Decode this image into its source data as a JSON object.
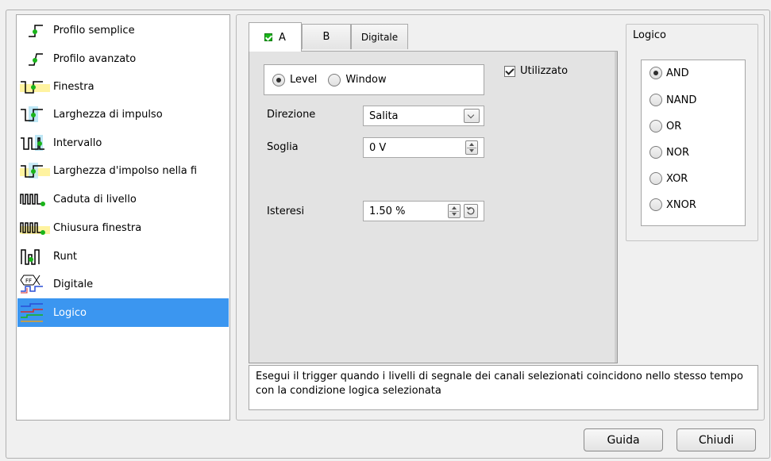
{
  "trigger_types": {
    "items": [
      {
        "label": "Profilo semplice",
        "icon": "simple-edge-icon"
      },
      {
        "label": "Profilo avanzato",
        "icon": "advanced-edge-icon"
      },
      {
        "label": "Finestra",
        "icon": "window-icon"
      },
      {
        "label": "Larghezza di impulso",
        "icon": "pulse-width-icon"
      },
      {
        "label": "Intervallo",
        "icon": "interval-icon"
      },
      {
        "label": "Larghezza d'impolso nella fi",
        "icon": "window-pulse-width-icon"
      },
      {
        "label": "Caduta di livello",
        "icon": "level-dropout-icon"
      },
      {
        "label": "Chiusura finestra",
        "icon": "window-dropout-icon"
      },
      {
        "label": "Runt",
        "icon": "runt-icon"
      },
      {
        "label": "Digitale",
        "icon": "digital-icon"
      },
      {
        "label": "Logico",
        "icon": "logic-icon"
      }
    ],
    "selected": "Logico"
  },
  "tabs": [
    {
      "label": "A",
      "checked": true,
      "active": true
    },
    {
      "label": "B",
      "checked": false,
      "active": false
    },
    {
      "label": "Digitale",
      "checked": false,
      "active": false
    }
  ],
  "channel": {
    "mode_options": [
      "Level",
      "Window"
    ],
    "mode_selected": "Level",
    "used_label": "Utilizzato",
    "used_checked": true,
    "direction_label": "Direzione",
    "direction_value": "Salita",
    "threshold_label": "Soglia",
    "threshold_value": "0 V",
    "hysteresis_label": "Isteresi",
    "hysteresis_value": "1.50 %"
  },
  "logic": {
    "title": "Logico",
    "options": [
      "AND",
      "NAND",
      "OR",
      "NOR",
      "XOR",
      "XNOR"
    ],
    "selected": "AND"
  },
  "description": "Esegui il trigger quando i livelli di segnale dei canali selezionati coincidono nello stesso tempo con la condizione logica selezionata",
  "buttons": {
    "help": "Guida",
    "close": "Chiudi"
  },
  "colors": {
    "selection": "#3b96f0",
    "icon_green": "#19b419",
    "icon_highlight": "#fff3a0"
  }
}
